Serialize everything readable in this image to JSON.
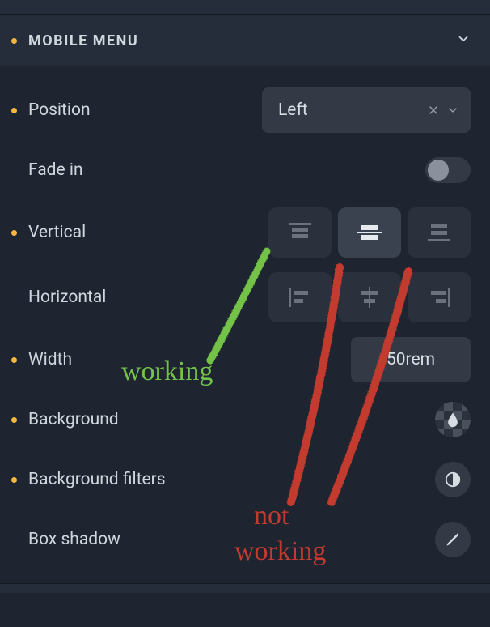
{
  "section": {
    "title": "MOBILE MENU"
  },
  "rows": {
    "position": {
      "label": "Position",
      "modified": true
    },
    "fade_in": {
      "label": "Fade in",
      "modified": false
    },
    "vertical": {
      "label": "Vertical",
      "modified": true
    },
    "horizontal": {
      "label": "Horizontal",
      "modified": false
    },
    "width": {
      "label": "Width",
      "modified": true
    },
    "background": {
      "label": "Background",
      "modified": true
    },
    "bg_filters": {
      "label": "Background filters",
      "modified": true
    },
    "box_shadow": {
      "label": "Box shadow",
      "modified": false
    }
  },
  "controls": {
    "position_select": {
      "value": "Left"
    },
    "fade_in_toggle": {
      "on": false
    },
    "vertical_align": {
      "selected": "middle"
    },
    "horizontal_align": {
      "selected": null
    },
    "width_input": {
      "value": "50rem"
    }
  },
  "annotations": {
    "working_label": "working",
    "not_working_label_line1": "not",
    "not_working_label_line2": "working"
  },
  "colors": {
    "accent_modified": "#f5b83d",
    "panel_bg": "#1e2530",
    "control_bg": "#333a46",
    "anno_green": "#74c24a",
    "anno_red": "#c23b2e"
  }
}
